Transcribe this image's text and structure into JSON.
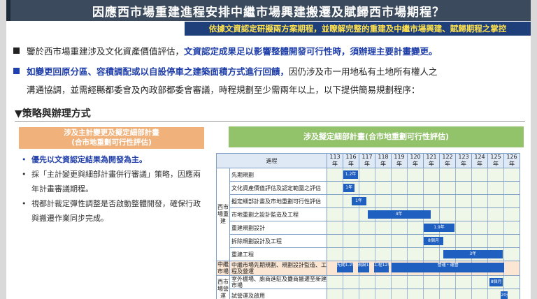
{
  "title": "因應西市場重建進程安排中繼市場興建搬遷及賦歸西市場期程？",
  "subtitle": "依據文資認定研擬兩方案期程，並瞭解完整的重建及中繼市場興建、賦歸期程之掌控",
  "paragraph1": {
    "plain": "鑒於西市場重建涉及文化資產價值評估，",
    "highlight": "文資認定成果足以影響整體開發可行性時，須辦理主要計畫變更。"
  },
  "paragraph2": {
    "highlight": "如變更回原分區、容積調配或以自設停車之建築面積方式進行回饋，",
    "plain1": "因仍涉及市一用地私有土地所有權人之",
    "plain2": "溝通協調，並需經縣都委會及內政部都委會審議，時程規劃至少需兩年以上，以下提供簡易規劃程序："
  },
  "strategy_heading": "▼策略與辦理方式",
  "left_box": {
    "line1": "涉及主計變更及擬定細部計畫",
    "line2": "(合市地重劃可行性評估)"
  },
  "left_items": [
    {
      "dot": "•",
      "text": "優先以文資認定結果為開發為主。",
      "blue": true
    },
    {
      "dot": "•",
      "text": "採「主計變更與細部計畫併行審議」策略，因應兩年計畫審議期程。",
      "blue": false
    },
    {
      "dot": "•",
      "text": "視都計裁定彈性調整是否啟動整體開發，確保行政與搬遷作業同步完成。",
      "blue": false
    }
  ],
  "right_box": "涉及擬定細部計畫(合市地重劃可行性評估)",
  "gantt": {
    "header": "進程",
    "years": [
      "113年",
      "116年",
      "117年",
      "118年",
      "119年",
      "120年",
      "121年",
      "122年",
      "123年",
      "124年",
      "125年",
      "126年"
    ],
    "groups": [
      {
        "label": "西市場重建",
        "rows": [
          {
            "task": "先期規劃",
            "bar": {
              "start": 1,
              "span": 1,
              "label": "1.2年"
            }
          },
          {
            "task": "文化資產價值評估及認定範圍之評估",
            "bar": {
              "start": 1,
              "span": 0.8,
              "label": "1年"
            }
          },
          {
            "task": "擬定細部計畫及市地重劃可行性評估",
            "bar": {
              "start": 1.5,
              "span": 1,
              "label": "1年"
            }
          },
          {
            "task": "市地重劃之設計監造及工程",
            "bar": {
              "start": 2.5,
              "span": 4,
              "label": "4年"
            }
          },
          {
            "task": "重建規劃設計",
            "bar": {
              "start": 6,
              "span": 2,
              "label": "1.9年"
            }
          },
          {
            "task": "拆除規劃設計及工程",
            "bar": {
              "start": 6,
              "span": 1.3,
              "label": "8個月"
            }
          },
          {
            "task": "重建工程",
            "bar": {
              "start": 7.2,
              "span": 3.8,
              "label": "3年"
            }
          }
        ]
      },
      {
        "label": "中繼市場",
        "rows": [
          {
            "task": "中繼市場先期規劃、規劃設計監造、工程及營運",
            "bars": [
              {
                "start": 0.6,
                "span": 1.1,
                "label": "先期1.2年"
              },
              {
                "start": 1.9,
                "span": 0.8,
                "label": "規設1年"
              },
              {
                "start": 2.9,
                "span": 1,
                "label": "工程12年"
              },
              {
                "start": 4,
                "span": 7.1,
                "label": "營運・運營"
              }
            ]
          }
        ]
      },
      {
        "label": "西市場營運",
        "rows": [
          {
            "task": "室外棚場、廁商進駐及攤商搬遷至新建市場",
            "bar": {
              "start": 10.1,
              "span": 0.9,
              "label": "8個月"
            }
          },
          {
            "task": "試營運及啟用",
            "bar": {
              "start": 10.8,
              "span": 0.5,
              "label": "20天"
            }
          }
        ]
      }
    ]
  }
}
